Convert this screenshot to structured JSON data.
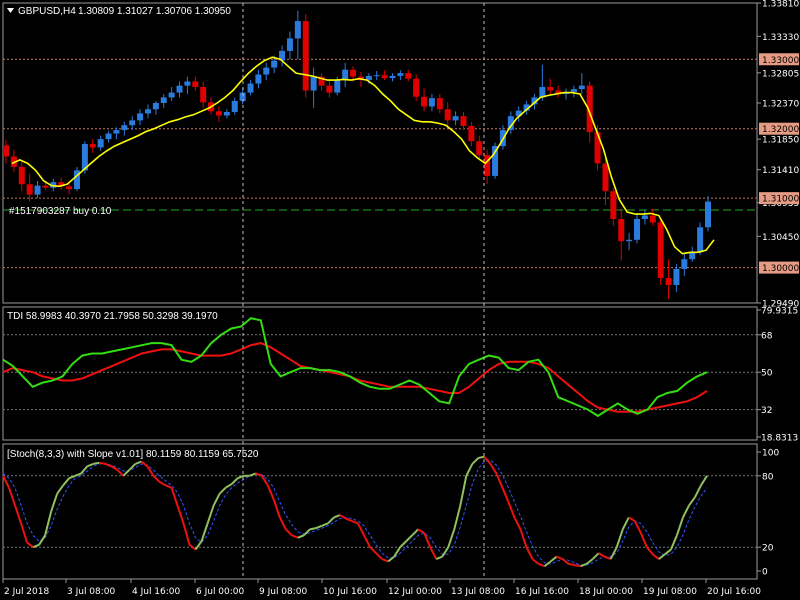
{
  "main_panel": {
    "symbol_label": "GBPUSD,H4",
    "ohlc_label": "1.30809 1.31027 1.30706 1.30950",
    "order_label": "#1517903287 buy 0.10",
    "y_ticks": [
      "1.33810",
      "1.33330",
      "1.32805",
      "1.32370",
      "1.31850",
      "1.31410",
      "1.30935",
      "1.30450",
      "1.29490"
    ],
    "ylim": [
      1.2949,
      1.3381
    ],
    "level_labels": [
      "1.33000",
      "1.32000",
      "1.31000",
      "1.30000"
    ],
    "level_values": [
      1.33,
      1.32,
      1.31,
      1.3
    ],
    "order_level": 1.3083,
    "up_color": "#2b7bdc",
    "down_color": "#e00000",
    "ma_color": "#ffff00"
  },
  "tdi_panel": {
    "label": "TDI 58.9983 40.3970 21.7958 50.3298 39.1970",
    "y_ticks": [
      "79.9315",
      "68",
      "50",
      "32",
      "18.8313"
    ],
    "ylim": [
      18.8313,
      79.9315
    ],
    "levels": [
      68,
      50,
      32
    ],
    "green_color": "#33dd11",
    "red_color": "#ee1111"
  },
  "stoch_panel": {
    "label": "[Stoch(8,3,3) with Slope v1.01] 80.1159 80.1159 65.7520",
    "y_ticks": [
      "100",
      "80",
      "20",
      "0"
    ],
    "ylim": [
      0,
      100
    ],
    "levels": [
      80,
      20
    ],
    "main_color": "#90c060",
    "down_color": "#ee1111",
    "signal_color": "#3355ff"
  },
  "x_ticks": [
    "2 Jul 2018",
    "3 Jul 08:00",
    "4 Jul 16:00",
    "6 Jul 00:00",
    "9 Jul 08:00",
    "10 Jul 16:00",
    "12 Jul 00:00",
    "13 Jul 08:00",
    "16 Jul 16:00",
    "18 Jul 00:00",
    "19 Jul 08:00",
    "20 Jul 16:00"
  ],
  "chart_data": [
    {
      "type": "candlestick",
      "title": "GBPUSD,H4",
      "ylim": [
        1.2949,
        1.3381
      ],
      "candles": [
        [
          1.3176,
          1.3184,
          1.315,
          1.316
        ],
        [
          1.316,
          1.317,
          1.3138,
          1.3145
        ],
        [
          1.3145,
          1.3155,
          1.311,
          1.312
        ],
        [
          1.312,
          1.3135,
          1.3095,
          1.3105
        ],
        [
          1.3105,
          1.3125,
          1.31,
          1.3118
        ],
        [
          1.3118,
          1.3125,
          1.3112,
          1.3115
        ],
        [
          1.3115,
          1.3128,
          1.311,
          1.3123
        ],
        [
          1.3123,
          1.313,
          1.3112,
          1.3117
        ],
        [
          1.3117,
          1.3124,
          1.3105,
          1.3113
        ],
        [
          1.3113,
          1.3145,
          1.311,
          1.314
        ],
        [
          1.314,
          1.3182,
          1.3135,
          1.3178
        ],
        [
          1.3178,
          1.3185,
          1.3165,
          1.3173
        ],
        [
          1.3173,
          1.319,
          1.3168,
          1.3185
        ],
        [
          1.3185,
          1.3197,
          1.318,
          1.3193
        ],
        [
          1.3193,
          1.3202,
          1.3185,
          1.3198
        ],
        [
          1.3198,
          1.321,
          1.319,
          1.3205
        ],
        [
          1.3205,
          1.3218,
          1.3198,
          1.3212
        ],
        [
          1.3212,
          1.3228,
          1.3205,
          1.3222
        ],
        [
          1.3222,
          1.3235,
          1.3215,
          1.3228
        ],
        [
          1.3228,
          1.324,
          1.322,
          1.3237
        ],
        [
          1.3237,
          1.325,
          1.323,
          1.3245
        ],
        [
          1.3245,
          1.326,
          1.324,
          1.3252
        ],
        [
          1.3252,
          1.3268,
          1.3245,
          1.3262
        ],
        [
          1.3262,
          1.3275,
          1.325,
          1.3268
        ],
        [
          1.3268,
          1.3275,
          1.3255,
          1.326
        ],
        [
          1.326,
          1.3268,
          1.323,
          1.3238
        ],
        [
          1.3238,
          1.3245,
          1.322,
          1.3225
        ],
        [
          1.3225,
          1.3232,
          1.321,
          1.3219
        ],
        [
          1.3219,
          1.3228,
          1.3215,
          1.3224
        ],
        [
          1.3224,
          1.3245,
          1.322,
          1.324
        ],
        [
          1.324,
          1.3258,
          1.3235,
          1.3252
        ],
        [
          1.3252,
          1.327,
          1.3248,
          1.3265
        ],
        [
          1.3265,
          1.3285,
          1.3258,
          1.3278
        ],
        [
          1.3278,
          1.3295,
          1.327,
          1.3288
        ],
        [
          1.3288,
          1.3305,
          1.328,
          1.3298
        ],
        [
          1.3298,
          1.332,
          1.329,
          1.3312
        ],
        [
          1.3312,
          1.334,
          1.33,
          1.333
        ],
        [
          1.333,
          1.337,
          1.33,
          1.3355
        ],
        [
          1.3355,
          1.3365,
          1.3245,
          1.3255
        ],
        [
          1.3255,
          1.3288,
          1.323,
          1.3275
        ],
        [
          1.3275,
          1.328,
          1.3255,
          1.3262
        ],
        [
          1.3262,
          1.327,
          1.3245,
          1.3252
        ],
        [
          1.3252,
          1.3275,
          1.3248,
          1.327
        ],
        [
          1.327,
          1.3295,
          1.326,
          1.3285
        ],
        [
          1.3285,
          1.329,
          1.3268,
          1.3275
        ],
        [
          1.3275,
          1.3282,
          1.326,
          1.327
        ],
        [
          1.327,
          1.328,
          1.3265,
          1.3276
        ],
        [
          1.3276,
          1.3283,
          1.327,
          1.3277
        ],
        [
          1.3277,
          1.3284,
          1.327,
          1.3273
        ],
        [
          1.3273,
          1.328,
          1.3268,
          1.3276
        ],
        [
          1.3276,
          1.3284,
          1.327,
          1.328
        ],
        [
          1.328,
          1.3285,
          1.3268,
          1.3272
        ],
        [
          1.3272,
          1.3278,
          1.324,
          1.3246
        ],
        [
          1.3246,
          1.3258,
          1.3225,
          1.3232
        ],
        [
          1.3232,
          1.325,
          1.3225,
          1.3244
        ],
        [
          1.3244,
          1.325,
          1.3222,
          1.3228
        ],
        [
          1.3228,
          1.3238,
          1.32,
          1.3212
        ],
        [
          1.3212,
          1.3225,
          1.3205,
          1.3218
        ],
        [
          1.3218,
          1.3224,
          1.3198,
          1.3204
        ],
        [
          1.3204,
          1.321,
          1.3175,
          1.3182
        ],
        [
          1.3182,
          1.319,
          1.3155,
          1.3162
        ],
        [
          1.3162,
          1.317,
          1.312,
          1.3132
        ],
        [
          1.3132,
          1.318,
          1.3128,
          1.3175
        ],
        [
          1.3175,
          1.3205,
          1.317,
          1.3198
        ],
        [
          1.3198,
          1.3225,
          1.3192,
          1.3218
        ],
        [
          1.3218,
          1.3232,
          1.321,
          1.3226
        ],
        [
          1.3226,
          1.324,
          1.322,
          1.3235
        ],
        [
          1.3235,
          1.325,
          1.3228,
          1.3245
        ],
        [
          1.3245,
          1.3292,
          1.324,
          1.326
        ],
        [
          1.326,
          1.3272,
          1.3248,
          1.3255
        ],
        [
          1.3255,
          1.3262,
          1.3245,
          1.325
        ],
        [
          1.325,
          1.3258,
          1.3242,
          1.3253
        ],
        [
          1.3253,
          1.3262,
          1.3245,
          1.3257
        ],
        [
          1.3257,
          1.328,
          1.325,
          1.3262
        ],
        [
          1.3262,
          1.3268,
          1.318,
          1.3195
        ],
        [
          1.3195,
          1.3205,
          1.314,
          1.315
        ],
        [
          1.315,
          1.316,
          1.309,
          1.311
        ],
        [
          1.311,
          1.3115,
          1.306,
          1.307
        ],
        [
          1.307,
          1.3085,
          1.301,
          1.3038
        ],
        [
          1.3038,
          1.305,
          1.3025,
          1.304
        ],
        [
          1.304,
          1.3078,
          1.3035,
          1.307
        ],
        [
          1.307,
          1.3082,
          1.3062,
          1.3075
        ],
        [
          1.3075,
          1.3085,
          1.306,
          1.3065
        ],
        [
          1.3065,
          1.3072,
          1.2975,
          1.2985
        ],
        [
          1.2985,
          1.3012,
          1.2955,
          1.2975
        ],
        [
          1.2975,
          1.3005,
          1.2965,
          1.2998
        ],
        [
          1.2998,
          1.302,
          1.2988,
          1.3012
        ],
        [
          1.3012,
          1.303,
          1.3008,
          1.3022
        ],
        [
          1.3022,
          1.3065,
          1.3018,
          1.3058
        ],
        [
          1.3058,
          1.3103,
          1.3052,
          1.3095
        ]
      ],
      "ma": [
        1.315,
        1.3155,
        1.315,
        1.314,
        1.3125,
        1.3118,
        1.3117,
        1.312,
        1.313,
        1.314,
        1.315,
        1.316,
        1.3168,
        1.3175,
        1.318,
        1.3185,
        1.319,
        1.3196,
        1.32,
        1.3205,
        1.321,
        1.3213,
        1.3217,
        1.322,
        1.3225,
        1.323,
        1.3237,
        1.3245,
        1.3255,
        1.3268,
        1.328,
        1.329,
        1.3298,
        1.3303,
        1.33,
        1.329,
        1.328,
        1.3278,
        1.3276,
        1.3273,
        1.327,
        1.327,
        1.3271,
        1.327,
        1.3272,
        1.327,
        1.3262,
        1.325,
        1.324,
        1.3228,
        1.322,
        1.3212,
        1.321,
        1.321,
        1.3208,
        1.3205,
        1.3196,
        1.3185,
        1.3168,
        1.3158,
        1.315,
        1.3162,
        1.318,
        1.32,
        1.3215,
        1.3225,
        1.3235,
        1.3245,
        1.3248,
        1.325,
        1.3252,
        1.3252,
        1.325,
        1.323,
        1.32,
        1.317,
        1.313,
        1.3098,
        1.308,
        1.3077,
        1.3077,
        1.3078,
        1.3075,
        1.3055,
        1.303,
        1.302,
        1.3022,
        1.3022,
        1.3025,
        1.304
      ]
    },
    {
      "type": "line",
      "title": "TDI",
      "ylim": [
        18.8313,
        79.9315
      ],
      "series": [
        {
          "name": "TDI green",
          "values": [
            56,
            53,
            48,
            43,
            45,
            46,
            48,
            54,
            58,
            59,
            59,
            60,
            61,
            62,
            63,
            64,
            64,
            63,
            56,
            55,
            58,
            64,
            68,
            71,
            72,
            76,
            75,
            54,
            48,
            50,
            52,
            52,
            51,
            51,
            50,
            48,
            45,
            43,
            42,
            42,
            44,
            46,
            44,
            40,
            36,
            35,
            48,
            54,
            56,
            58,
            57,
            52,
            51,
            55,
            56,
            50,
            38,
            36,
            34,
            32,
            29,
            32,
            35,
            32,
            30,
            32,
            38,
            40,
            41,
            45,
            48,
            50
          ]
        },
        {
          "name": "TDI red",
          "values": [
            50,
            52,
            51,
            50,
            48,
            47,
            46,
            46,
            47,
            49,
            51,
            53,
            55,
            57,
            59,
            60,
            61,
            61,
            60,
            59,
            58,
            58,
            58,
            59,
            61,
            63,
            64,
            62,
            59,
            56,
            53,
            52,
            51,
            50,
            49,
            48,
            46,
            45,
            44,
            43,
            43,
            43,
            43,
            42,
            41,
            40,
            40,
            43,
            47,
            51,
            54,
            55,
            55,
            55,
            54,
            52,
            48,
            44,
            40,
            36,
            33,
            32,
            31,
            31,
            31,
            32,
            33,
            34,
            35,
            36,
            38,
            41
          ]
        }
      ]
    },
    {
      "type": "line",
      "title": "Stoch(8,3,3)",
      "ylim": [
        0,
        100
      ],
      "series": [
        {
          "name": "main",
          "values": [
            80,
            70,
            55,
            40,
            24,
            20,
            22,
            30,
            50,
            65,
            72,
            78,
            80,
            82,
            88,
            90,
            91,
            90,
            88,
            85,
            80,
            85,
            90,
            92,
            88,
            80,
            75,
            72,
            70,
            55,
            40,
            22,
            18,
            25,
            40,
            55,
            65,
            70,
            73,
            78,
            80,
            80,
            82,
            80,
            72,
            60,
            45,
            35,
            30,
            28,
            30,
            35,
            36,
            38,
            40,
            45,
            47,
            44,
            42,
            40,
            30,
            20,
            15,
            10,
            8,
            12,
            20,
            25,
            30,
            35,
            32,
            20,
            10,
            12,
            20,
            35,
            55,
            80,
            90,
            95,
            96,
            90,
            82,
            70,
            58,
            45,
            35,
            20,
            10,
            6,
            4,
            8,
            12,
            10,
            6,
            5,
            4,
            6,
            10,
            15,
            12,
            10,
            20,
            35,
            45,
            42,
            32,
            20,
            14,
            10,
            14,
            18,
            30,
            45,
            55,
            62,
            72,
            80
          ]
        },
        {
          "name": "signal",
          "values": [
            82,
            78,
            70,
            55,
            40,
            30,
            25,
            28,
            38,
            52,
            63,
            72,
            78,
            80,
            84,
            88,
            90,
            90,
            89,
            87,
            84,
            84,
            87,
            90,
            89,
            85,
            80,
            76,
            72,
            66,
            55,
            40,
            28,
            24,
            30,
            42,
            55,
            64,
            70,
            74,
            77,
            80,
            81,
            81,
            77,
            70,
            58,
            47,
            39,
            33,
            31,
            32,
            34,
            36,
            38,
            41,
            44,
            45,
            44,
            42,
            38,
            30,
            22,
            15,
            11,
            11,
            15,
            20,
            25,
            30,
            32,
            28,
            20,
            14,
            14,
            22,
            37,
            55,
            73,
            86,
            92,
            93,
            89,
            81,
            70,
            58,
            46,
            33,
            21,
            12,
            7,
            6,
            8,
            10,
            9,
            7,
            5,
            5,
            7,
            10,
            12,
            12,
            15,
            25,
            37,
            42,
            40,
            33,
            24,
            16,
            13,
            14,
            20,
            30,
            43,
            54,
            63,
            70
          ]
        }
      ]
    }
  ]
}
